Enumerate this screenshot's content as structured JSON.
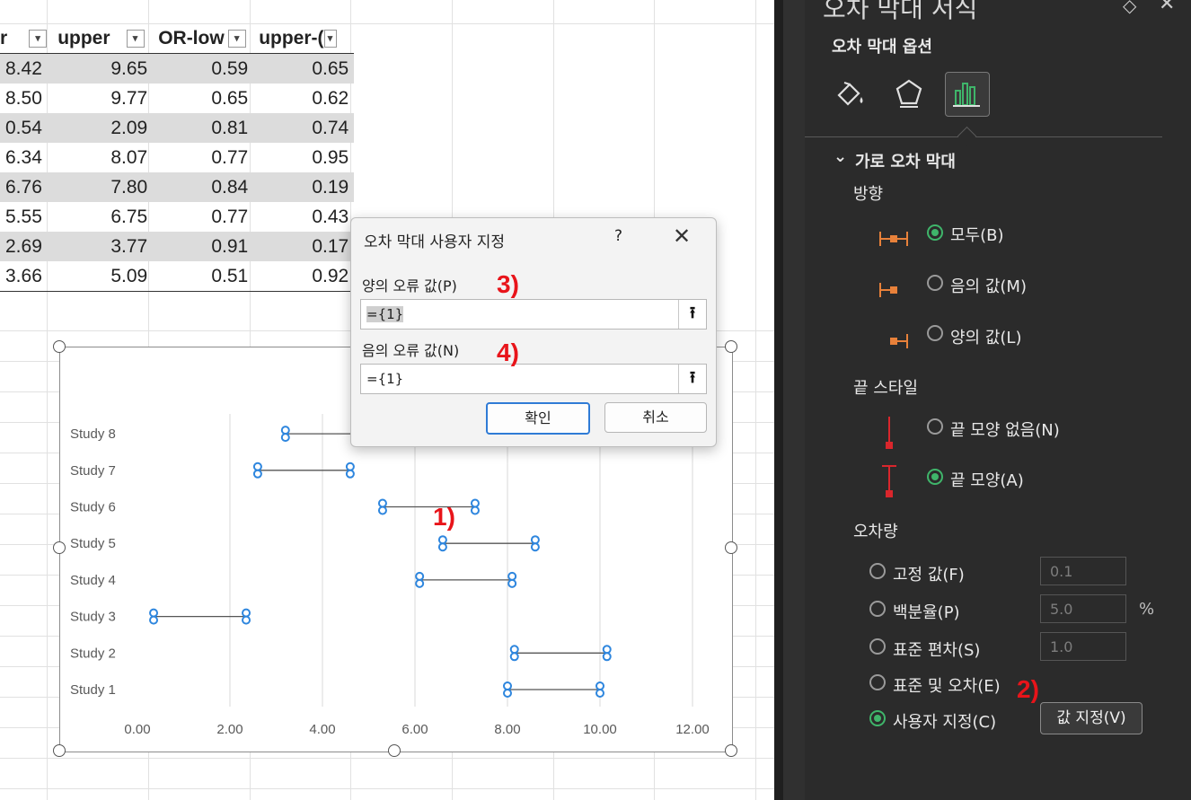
{
  "sheet": {
    "headers": [
      "r",
      "upper",
      "OR-low",
      "upper-("
    ],
    "rows": [
      [
        "8.42",
        "9.65",
        "0.59",
        "0.65"
      ],
      [
        "8.50",
        "9.77",
        "0.65",
        "0.62"
      ],
      [
        "0.54",
        "2.09",
        "0.81",
        "0.74"
      ],
      [
        "6.34",
        "8.07",
        "0.77",
        "0.95"
      ],
      [
        "6.76",
        "7.80",
        "0.84",
        "0.19"
      ],
      [
        "5.55",
        "6.75",
        "0.77",
        "0.43"
      ],
      [
        "2.69",
        "3.77",
        "0.91",
        "0.17"
      ],
      [
        "3.66",
        "5.09",
        "0.51",
        "0.92"
      ]
    ]
  },
  "chart_data": {
    "type": "scatter",
    "categories": [
      "Study 1",
      "Study 2",
      "Study 3",
      "Study 4",
      "Study 5",
      "Study 6",
      "Study 7",
      "Study 8"
    ],
    "intervals": [
      {
        "low": 8.0,
        "high": 10.0
      },
      {
        "low": 8.15,
        "high": 10.15
      },
      {
        "low": 0.35,
        "high": 2.35
      },
      {
        "low": 6.1,
        "high": 8.1
      },
      {
        "low": 6.6,
        "high": 8.6
      },
      {
        "low": 5.3,
        "high": 7.3
      },
      {
        "low": 2.6,
        "high": 4.6
      },
      {
        "low": 3.2,
        "high": 5.2
      }
    ],
    "xticks": [
      "0.00",
      "2.00",
      "4.00",
      "6.00",
      "8.00",
      "10.00",
      "12.00"
    ],
    "xlim": [
      0,
      12
    ],
    "grid": "vertical",
    "marker_color": "#2e86de",
    "line_color": "#555555"
  },
  "dialog": {
    "title": "오차 막대 사용자 지정",
    "help": "?",
    "close": "✕",
    "positive_label": "양의 오류 값(P)",
    "positive_value": "={1}",
    "negative_label": "음의 오류 값(N)",
    "negative_value": "={1}",
    "ok": "확인",
    "cancel": "취소",
    "collapse_glyph": "⭱"
  },
  "annotations": {
    "a1": "1)",
    "a2": "2)",
    "a3": "3)",
    "a4": "4)"
  },
  "pane": {
    "title": "오차 막대 서식",
    "options_header": "오차 막대 옵션",
    "section": "가로 오차 막대",
    "direction_header": "방향",
    "direction": [
      "모두(B)",
      "음의 값(M)",
      "양의 값(L)"
    ],
    "endstyle_header": "끝 스타일",
    "endstyle": [
      "끝 모양 없음(N)",
      "끝 모양(A)"
    ],
    "amount_header": "오차량",
    "amount": [
      "고정 값(F)",
      "백분율(P)",
      "표준 편차(S)",
      "표준 및 오차(E)",
      "사용자 지정(C)"
    ],
    "fixed_value": "0.1",
    "percent_value": "5.0",
    "percent_unit": "%",
    "stdev_value": "1.0",
    "specify_button": "값 지정(V)",
    "accent": "#3fb56a",
    "orange": "#e8813a",
    "red": "#d9262c"
  }
}
